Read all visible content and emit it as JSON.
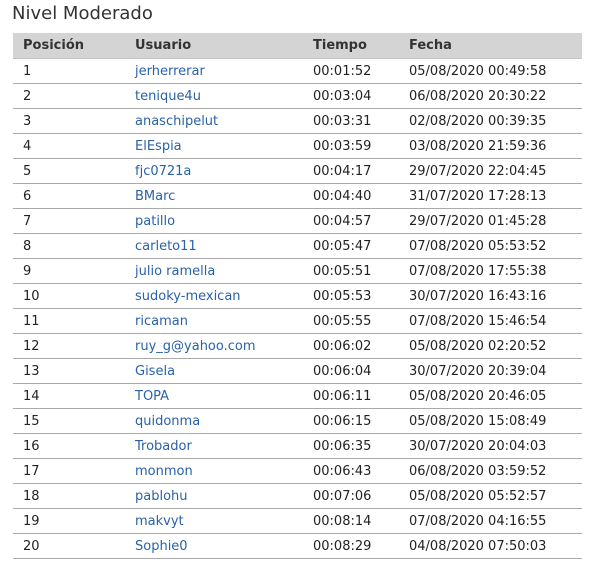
{
  "title": "Nivel Moderado",
  "colors": {
    "header_bg": "#d4d4d4",
    "link": "#2a62a8",
    "row_border": "#a9a9a9"
  },
  "table": {
    "headers": [
      "Posición",
      "Usuario",
      "Tiempo",
      "Fecha"
    ],
    "rows": [
      {
        "pos": "1",
        "user": "jerherrerar",
        "time": "00:01:52",
        "date": "05/08/2020 00:49:58"
      },
      {
        "pos": "2",
        "user": "tenique4u",
        "time": "00:03:04",
        "date": "06/08/2020 20:30:22"
      },
      {
        "pos": "3",
        "user": "anaschipelut",
        "time": "00:03:31",
        "date": "02/08/2020 00:39:35"
      },
      {
        "pos": "4",
        "user": "ElEspia",
        "time": "00:03:59",
        "date": "03/08/2020 21:59:36"
      },
      {
        "pos": "5",
        "user": "fjc0721a",
        "time": "00:04:17",
        "date": "29/07/2020 22:04:45"
      },
      {
        "pos": "6",
        "user": "BMarc",
        "time": "00:04:40",
        "date": "31/07/2020 17:28:13"
      },
      {
        "pos": "7",
        "user": "patillo",
        "time": "00:04:57",
        "date": "29/07/2020 01:45:28"
      },
      {
        "pos": "8",
        "user": "carleto11",
        "time": "00:05:47",
        "date": "07/08/2020 05:53:52"
      },
      {
        "pos": "9",
        "user": "julio ramella",
        "time": "00:05:51",
        "date": "07/08/2020 17:55:38"
      },
      {
        "pos": "10",
        "user": "sudoky-mexican",
        "time": "00:05:53",
        "date": "30/07/2020 16:43:16"
      },
      {
        "pos": "11",
        "user": "ricaman",
        "time": "00:05:55",
        "date": "07/08/2020 15:46:54"
      },
      {
        "pos": "12",
        "user": "ruy_g@yahoo.com",
        "time": "00:06:02",
        "date": "05/08/2020 02:20:52"
      },
      {
        "pos": "13",
        "user": "Gisela",
        "time": "00:06:04",
        "date": "30/07/2020 20:39:04"
      },
      {
        "pos": "14",
        "user": "TOPA",
        "time": "00:06:11",
        "date": "05/08/2020 20:46:05"
      },
      {
        "pos": "15",
        "user": "quidonma",
        "time": "00:06:15",
        "date": "05/08/2020 15:08:49"
      },
      {
        "pos": "16",
        "user": "Trobador",
        "time": "00:06:35",
        "date": "30/07/2020 20:04:03"
      },
      {
        "pos": "17",
        "user": "monmon",
        "time": "00:06:43",
        "date": "06/08/2020 03:59:52"
      },
      {
        "pos": "18",
        "user": "pablohu",
        "time": "00:07:06",
        "date": "05/08/2020 05:52:57"
      },
      {
        "pos": "19",
        "user": "makvyt",
        "time": "00:08:14",
        "date": "07/08/2020 04:16:55"
      },
      {
        "pos": "20",
        "user": "Sophie0",
        "time": "00:08:29",
        "date": "04/08/2020 07:50:03"
      }
    ]
  }
}
